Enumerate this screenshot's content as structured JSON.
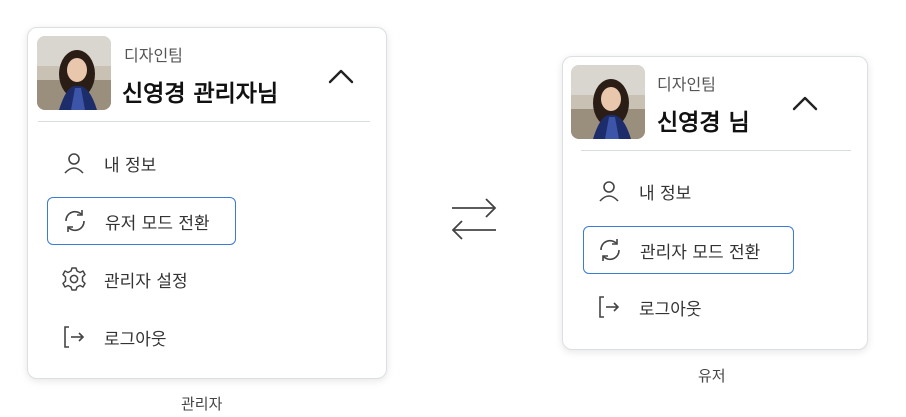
{
  "admin_panel": {
    "team": "디자인팀",
    "user_name": "신영경 관리자님",
    "menu": [
      {
        "label": "내 정보",
        "icon": "user-icon"
      },
      {
        "label": "유저 모드 전환",
        "icon": "refresh-icon",
        "selected": true
      },
      {
        "label": "관리자 설정",
        "icon": "gear-icon"
      },
      {
        "label": "로그아웃",
        "icon": "logout-icon"
      }
    ],
    "caption": "관리자"
  },
  "user_panel": {
    "team": "디자인팀",
    "user_name": "신영경 님",
    "menu": [
      {
        "label": "내 정보",
        "icon": "user-icon"
      },
      {
        "label": "관리자 모드 전환",
        "icon": "refresh-icon",
        "selected": true
      },
      {
        "label": "로그아웃",
        "icon": "logout-icon"
      }
    ],
    "caption": "유저"
  },
  "colors": {
    "selected_border": "#3a7bd5",
    "card_border": "#dcdfe4",
    "text": "#333333"
  }
}
